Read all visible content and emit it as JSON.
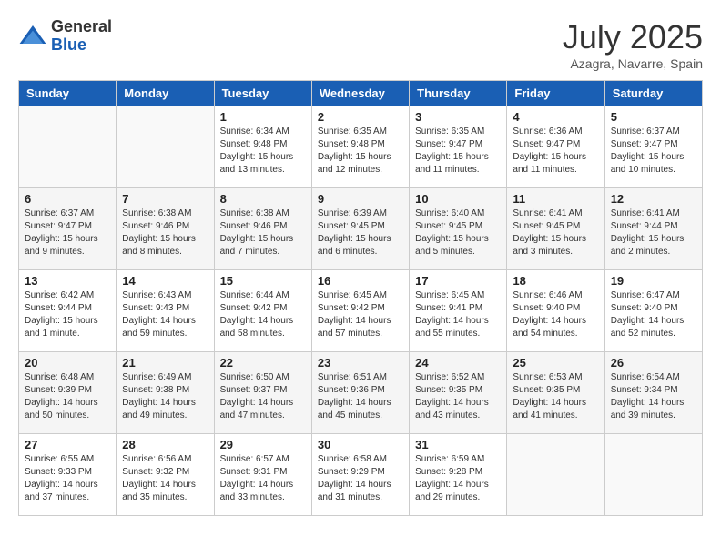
{
  "logo": {
    "general": "General",
    "blue": "Blue"
  },
  "title": "July 2025",
  "location": "Azagra, Navarre, Spain",
  "days_of_week": [
    "Sunday",
    "Monday",
    "Tuesday",
    "Wednesday",
    "Thursday",
    "Friday",
    "Saturday"
  ],
  "weeks": [
    [
      {
        "num": "",
        "sunrise": "",
        "sunset": "",
        "daylight": ""
      },
      {
        "num": "",
        "sunrise": "",
        "sunset": "",
        "daylight": ""
      },
      {
        "num": "1",
        "sunrise": "Sunrise: 6:34 AM",
        "sunset": "Sunset: 9:48 PM",
        "daylight": "Daylight: 15 hours and 13 minutes."
      },
      {
        "num": "2",
        "sunrise": "Sunrise: 6:35 AM",
        "sunset": "Sunset: 9:48 PM",
        "daylight": "Daylight: 15 hours and 12 minutes."
      },
      {
        "num": "3",
        "sunrise": "Sunrise: 6:35 AM",
        "sunset": "Sunset: 9:47 PM",
        "daylight": "Daylight: 15 hours and 11 minutes."
      },
      {
        "num": "4",
        "sunrise": "Sunrise: 6:36 AM",
        "sunset": "Sunset: 9:47 PM",
        "daylight": "Daylight: 15 hours and 11 minutes."
      },
      {
        "num": "5",
        "sunrise": "Sunrise: 6:37 AM",
        "sunset": "Sunset: 9:47 PM",
        "daylight": "Daylight: 15 hours and 10 minutes."
      }
    ],
    [
      {
        "num": "6",
        "sunrise": "Sunrise: 6:37 AM",
        "sunset": "Sunset: 9:47 PM",
        "daylight": "Daylight: 15 hours and 9 minutes."
      },
      {
        "num": "7",
        "sunrise": "Sunrise: 6:38 AM",
        "sunset": "Sunset: 9:46 PM",
        "daylight": "Daylight: 15 hours and 8 minutes."
      },
      {
        "num": "8",
        "sunrise": "Sunrise: 6:38 AM",
        "sunset": "Sunset: 9:46 PM",
        "daylight": "Daylight: 15 hours and 7 minutes."
      },
      {
        "num": "9",
        "sunrise": "Sunrise: 6:39 AM",
        "sunset": "Sunset: 9:45 PM",
        "daylight": "Daylight: 15 hours and 6 minutes."
      },
      {
        "num": "10",
        "sunrise": "Sunrise: 6:40 AM",
        "sunset": "Sunset: 9:45 PM",
        "daylight": "Daylight: 15 hours and 5 minutes."
      },
      {
        "num": "11",
        "sunrise": "Sunrise: 6:41 AM",
        "sunset": "Sunset: 9:45 PM",
        "daylight": "Daylight: 15 hours and 3 minutes."
      },
      {
        "num": "12",
        "sunrise": "Sunrise: 6:41 AM",
        "sunset": "Sunset: 9:44 PM",
        "daylight": "Daylight: 15 hours and 2 minutes."
      }
    ],
    [
      {
        "num": "13",
        "sunrise": "Sunrise: 6:42 AM",
        "sunset": "Sunset: 9:44 PM",
        "daylight": "Daylight: 15 hours and 1 minute."
      },
      {
        "num": "14",
        "sunrise": "Sunrise: 6:43 AM",
        "sunset": "Sunset: 9:43 PM",
        "daylight": "Daylight: 14 hours and 59 minutes."
      },
      {
        "num": "15",
        "sunrise": "Sunrise: 6:44 AM",
        "sunset": "Sunset: 9:42 PM",
        "daylight": "Daylight: 14 hours and 58 minutes."
      },
      {
        "num": "16",
        "sunrise": "Sunrise: 6:45 AM",
        "sunset": "Sunset: 9:42 PM",
        "daylight": "Daylight: 14 hours and 57 minutes."
      },
      {
        "num": "17",
        "sunrise": "Sunrise: 6:45 AM",
        "sunset": "Sunset: 9:41 PM",
        "daylight": "Daylight: 14 hours and 55 minutes."
      },
      {
        "num": "18",
        "sunrise": "Sunrise: 6:46 AM",
        "sunset": "Sunset: 9:40 PM",
        "daylight": "Daylight: 14 hours and 54 minutes."
      },
      {
        "num": "19",
        "sunrise": "Sunrise: 6:47 AM",
        "sunset": "Sunset: 9:40 PM",
        "daylight": "Daylight: 14 hours and 52 minutes."
      }
    ],
    [
      {
        "num": "20",
        "sunrise": "Sunrise: 6:48 AM",
        "sunset": "Sunset: 9:39 PM",
        "daylight": "Daylight: 14 hours and 50 minutes."
      },
      {
        "num": "21",
        "sunrise": "Sunrise: 6:49 AM",
        "sunset": "Sunset: 9:38 PM",
        "daylight": "Daylight: 14 hours and 49 minutes."
      },
      {
        "num": "22",
        "sunrise": "Sunrise: 6:50 AM",
        "sunset": "Sunset: 9:37 PM",
        "daylight": "Daylight: 14 hours and 47 minutes."
      },
      {
        "num": "23",
        "sunrise": "Sunrise: 6:51 AM",
        "sunset": "Sunset: 9:36 PM",
        "daylight": "Daylight: 14 hours and 45 minutes."
      },
      {
        "num": "24",
        "sunrise": "Sunrise: 6:52 AM",
        "sunset": "Sunset: 9:35 PM",
        "daylight": "Daylight: 14 hours and 43 minutes."
      },
      {
        "num": "25",
        "sunrise": "Sunrise: 6:53 AM",
        "sunset": "Sunset: 9:35 PM",
        "daylight": "Daylight: 14 hours and 41 minutes."
      },
      {
        "num": "26",
        "sunrise": "Sunrise: 6:54 AM",
        "sunset": "Sunset: 9:34 PM",
        "daylight": "Daylight: 14 hours and 39 minutes."
      }
    ],
    [
      {
        "num": "27",
        "sunrise": "Sunrise: 6:55 AM",
        "sunset": "Sunset: 9:33 PM",
        "daylight": "Daylight: 14 hours and 37 minutes."
      },
      {
        "num": "28",
        "sunrise": "Sunrise: 6:56 AM",
        "sunset": "Sunset: 9:32 PM",
        "daylight": "Daylight: 14 hours and 35 minutes."
      },
      {
        "num": "29",
        "sunrise": "Sunrise: 6:57 AM",
        "sunset": "Sunset: 9:31 PM",
        "daylight": "Daylight: 14 hours and 33 minutes."
      },
      {
        "num": "30",
        "sunrise": "Sunrise: 6:58 AM",
        "sunset": "Sunset: 9:29 PM",
        "daylight": "Daylight: 14 hours and 31 minutes."
      },
      {
        "num": "31",
        "sunrise": "Sunrise: 6:59 AM",
        "sunset": "Sunset: 9:28 PM",
        "daylight": "Daylight: 14 hours and 29 minutes."
      },
      {
        "num": "",
        "sunrise": "",
        "sunset": "",
        "daylight": ""
      },
      {
        "num": "",
        "sunrise": "",
        "sunset": "",
        "daylight": ""
      }
    ]
  ]
}
